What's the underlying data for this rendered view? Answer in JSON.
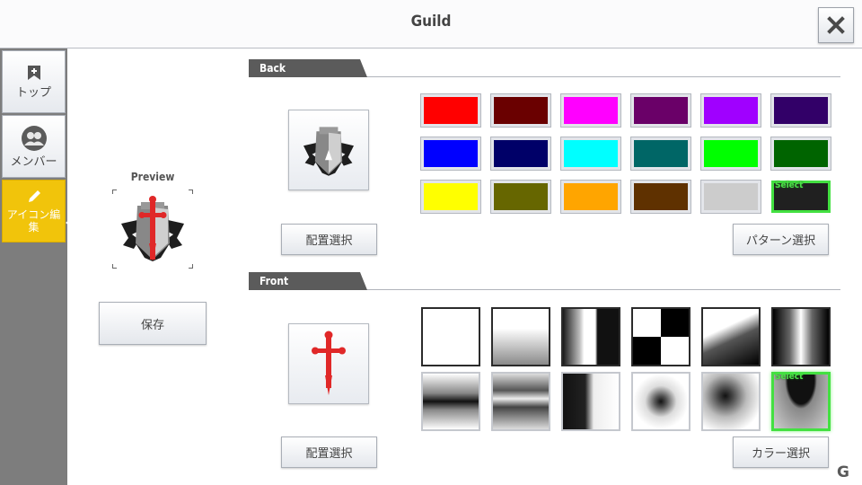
{
  "header": {
    "title": "Guild"
  },
  "sidebar": {
    "items": [
      {
        "label": "トップ"
      },
      {
        "label": "メンバー"
      },
      {
        "label": "アイコン編集"
      }
    ]
  },
  "preview": {
    "label": "Preview",
    "save_label": "保存"
  },
  "back": {
    "title": "Back",
    "placement_label": "配置選択",
    "pattern_label": "パターン選択",
    "select_tag": "Select",
    "colors": [
      "#ff0000",
      "#6a0000",
      "#ff00ff",
      "#6a0068",
      "#a000ff",
      "#320068",
      "#0000ff",
      "#000068",
      "#00ffff",
      "#006666",
      "#00ff00",
      "#006400",
      "#ffff00",
      "#666600",
      "#ffa500",
      "#5f3100",
      "#cccccc",
      "#202020"
    ],
    "selected_index": 17
  },
  "front": {
    "title": "Front",
    "placement_label": "配置選択",
    "color_label": "カラー選択",
    "select_tag": "Select",
    "selected_index": 11
  },
  "accent": {
    "selected": "#43e041",
    "active_tab": "#f1c40b"
  },
  "watermark": "G"
}
